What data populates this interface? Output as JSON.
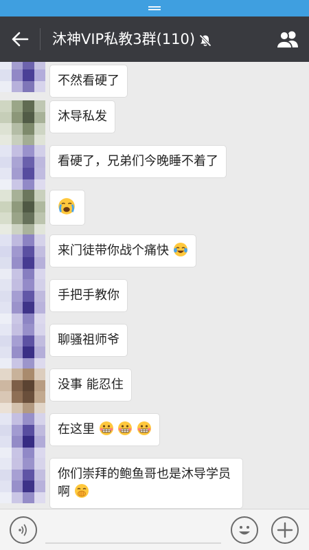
{
  "header": {
    "title": "沐神VIP私教3群(110)",
    "back_icon": "arrow-left-icon",
    "mute_icon": "bell-muted-icon",
    "members_icon": "group-members-icon"
  },
  "messages": [
    {
      "text": "不然看硬了",
      "emoji": []
    },
    {
      "text": "沐导私发",
      "emoji": []
    },
    {
      "text": "看硬了，兄弟们今晚睡不着了",
      "emoji": []
    },
    {
      "text": "",
      "emoji": [
        "crying-face-emoji"
      ]
    },
    {
      "text": "来门徒带你战个痛快",
      "emoji": [
        "tears-of-joy-emoji"
      ]
    },
    {
      "text": "手把手教你",
      "emoji": []
    },
    {
      "text": "聊骚祖师爷",
      "emoji": []
    },
    {
      "text": "没事 能忍住",
      "emoji": []
    },
    {
      "text": "在这里",
      "emoji": [
        "grimacing-emoji",
        "grimacing-emoji",
        "grimacing-emoji"
      ]
    },
    {
      "text": "你们崇拜的鲍鱼哥也是沐导学员啊",
      "emoji": [
        "hand-over-mouth-emoji"
      ]
    }
  ],
  "input": {
    "value": "",
    "placeholder": "",
    "voice_icon": "voice-icon",
    "emoji_icon": "emoji-face-icon",
    "plus_icon": "plus-icon"
  },
  "colors": {
    "status_bar": "#3f9fe0",
    "title_bar": "#393a3f",
    "chat_background": "#ebebeb",
    "bubble": "#ffffff"
  }
}
